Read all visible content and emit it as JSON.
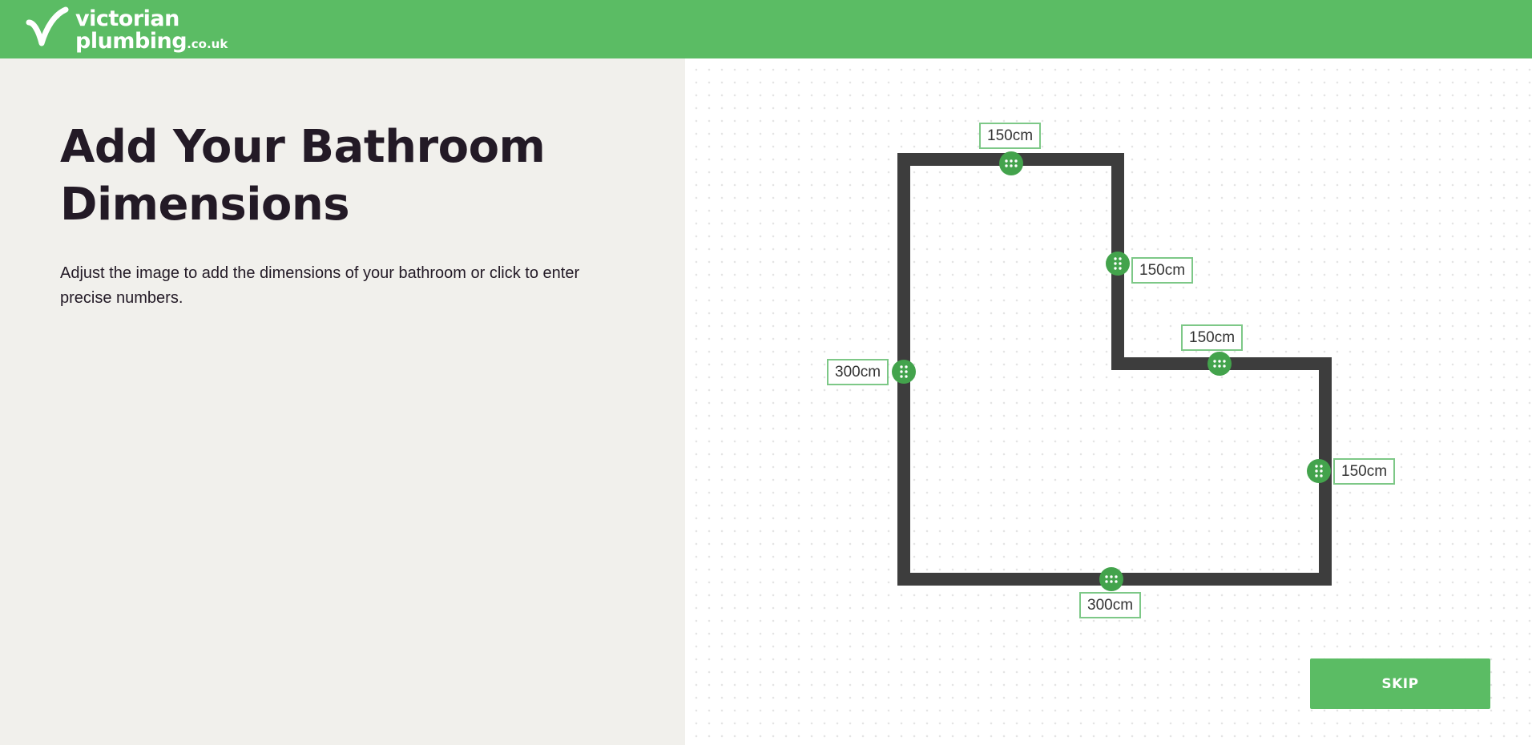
{
  "brand": {
    "line1": "victorian",
    "line2": "plumbing",
    "suffix": ".co.uk",
    "color": "#5bbc64"
  },
  "main": {
    "title_line1": "Add Your Bathroom",
    "title_line2": "Dimensions",
    "description": "Adjust the image to add the dimensions of your bathroom or click to enter precise numbers."
  },
  "floorplan": {
    "shape": "L-shaped room",
    "wall_color": "#3d3d3d",
    "handle_color": "#43a34c",
    "dimensions": {
      "top_wall": "150cm",
      "inner_vertical_wall": "150cm",
      "inner_horizontal_wall": "150cm",
      "right_wall": "150cm",
      "bottom_wall": "300cm",
      "left_wall": "300cm"
    }
  },
  "actions": {
    "skip_label": "SKIP"
  },
  "icons": {
    "logo": "victorian-plumbing-v-logo",
    "handle": "drag-handle-dots-icon"
  }
}
